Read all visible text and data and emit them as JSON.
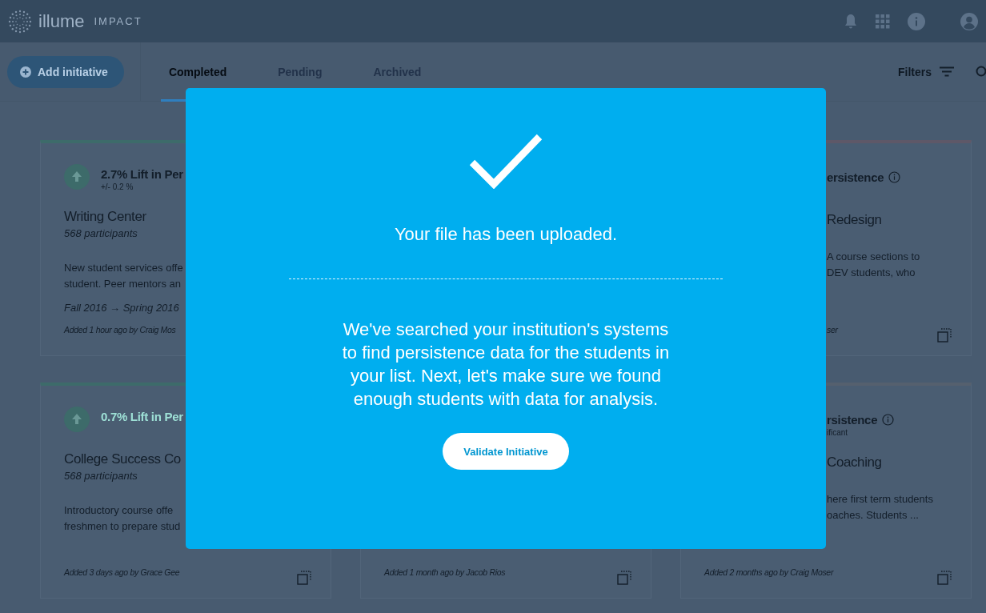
{
  "header": {
    "logo": "illume",
    "product": "IMPACT"
  },
  "toolbar": {
    "add_button": "Add initiative",
    "tabs": [
      {
        "label": "Completed",
        "selected": true
      },
      {
        "label": "Pending",
        "selected": false
      },
      {
        "label": "Archived",
        "selected": false
      }
    ],
    "filters": "Filters"
  },
  "rows": [
    {
      "cards": [
        {
          "color": "#3d6b6a",
          "lift": "2.7% Lift in Per",
          "highlighted": false,
          "arrow_icon": true,
          "margin": "+/- 0.2 %",
          "title": "Writing Center",
          "participants": "568 participants",
          "description": [
            "New student services offe",
            "student. Peer mentors an"
          ],
          "dates": "Fall 2016 → Spring 2016",
          "added": "Added 1 hour ago by Craig Mos",
          "copy_button": false
        },
        {
          "color": "#5e5868",
          "lift": "ersistence",
          "highlighted": false,
          "arrow_icon": false,
          "info_icon": true,
          "title": "Redesign",
          "description": [
            "A course sections to",
            "DEV students, who"
          ],
          "added": "ser",
          "copy_button": true
        }
      ]
    },
    {
      "cards": [
        {
          "color": "#3d6b6a",
          "lift": "0.7% Lift in Per",
          "highlighted": true,
          "arrow_icon": true,
          "title": "College Success Co",
          "participants": "568 participants",
          "description": [
            "Introductory course offe",
            "freshmen to prepare stud"
          ],
          "added": "Added 3 days ago by Grace Gee",
          "copy_button": true
        },
        {
          "color": "#3d6b6a",
          "added": "Added 1 month ago by Jacob Rios",
          "copy_button": true
        },
        {
          "color": "#55606e",
          "lift": "rsistence",
          "highlighted": false,
          "arrow_icon": false,
          "info_icon": true,
          "margin": "ificant",
          "title": "Coaching",
          "description": [
            "here first term students",
            "oaches. Students ..."
          ],
          "added": "Added 2 months ago by Craig Moser",
          "copy_button": true
        }
      ]
    }
  ],
  "modal": {
    "title": "Your file has been uploaded.",
    "body": "We've searched your institution's systems to find persistence data for the students in your list. Next, let's make sure we found enough students with data for analysis.",
    "button": "Validate Initiative"
  }
}
